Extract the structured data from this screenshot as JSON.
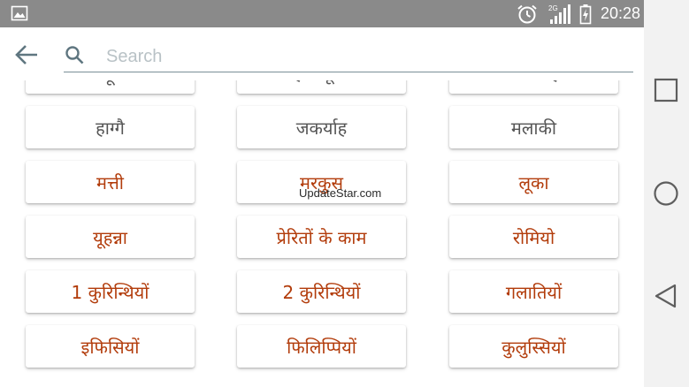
{
  "status_bar": {
    "time": "20:28",
    "network_label": "2G"
  },
  "search": {
    "placeholder": "Search"
  },
  "books": [
    [
      {
        "label": "नहूम",
        "color": "gray"
      },
      {
        "label": "हबक्कूक",
        "color": "gray"
      },
      {
        "label": "सपन्याह",
        "color": "gray"
      }
    ],
    [
      {
        "label": "हाग्गै",
        "color": "gray"
      },
      {
        "label": "जकर्याह",
        "color": "gray"
      },
      {
        "label": "मलाकी",
        "color": "gray"
      }
    ],
    [
      {
        "label": "मत्ती",
        "color": "red"
      },
      {
        "label": "मरकुस",
        "color": "red"
      },
      {
        "label": "लूका",
        "color": "red"
      }
    ],
    [
      {
        "label": "यूहन्ना",
        "color": "red"
      },
      {
        "label": "प्रेरितों के काम",
        "color": "red"
      },
      {
        "label": "रोमियो",
        "color": "red"
      }
    ],
    [
      {
        "label": "1 कुरिन्थियों",
        "color": "red"
      },
      {
        "label": "2 कुरिन्थियों",
        "color": "red"
      },
      {
        "label": "गलातियों",
        "color": "red"
      }
    ],
    [
      {
        "label": "इफिसियों",
        "color": "red"
      },
      {
        "label": "फिलिप्पियों",
        "color": "red"
      },
      {
        "label": "कुलुस्सियों",
        "color": "red"
      }
    ]
  ],
  "watermark": "UpdateStar.com",
  "colors": {
    "status_bar": "#8a8a8a",
    "old_testament_text": "#555555",
    "new_testament_text": "#b23c0b",
    "search_underline": "#7a8f97",
    "nav_bar": "#f2f2f2"
  },
  "icons": {
    "status_left": "image-icon",
    "alarm": "alarm-clock-icon",
    "signal": "signal-icon",
    "battery": "battery-charging-icon",
    "back": "arrow-back-icon",
    "search": "search-icon",
    "nav_recents": "square-icon",
    "nav_home": "circle-icon",
    "nav_back": "triangle-back-icon"
  }
}
